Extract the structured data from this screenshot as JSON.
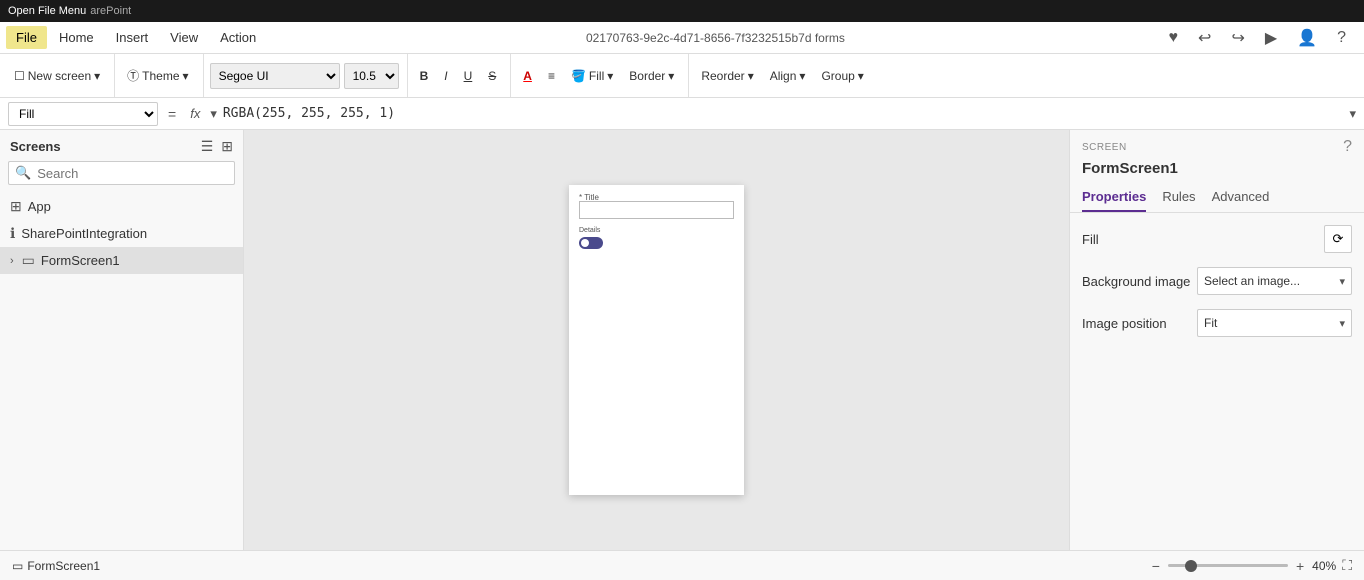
{
  "titlebar": {
    "open_file_menu": "Open File Menu",
    "sharepoint": "arePoint"
  },
  "menubar": {
    "items": [
      "File",
      "Home",
      "Insert",
      "View",
      "Action"
    ],
    "active_item": "File",
    "app_id": "02170763-9e2c-4d71-8656-7f3232515b7d forms"
  },
  "toolbar": {
    "new_screen_label": "New screen",
    "theme_label": "Theme",
    "font_name": "Segoe UI",
    "font_size": "10.5",
    "bold_label": "B",
    "italic_label": "I",
    "underline_label": "U",
    "strikethrough_label": "S",
    "font_color_label": "A",
    "align_label": "≡",
    "fill_label": "Fill",
    "border_label": "Border",
    "reorder_label": "Reorder",
    "align_btn_label": "Align",
    "group_label": "Group"
  },
  "formula_bar": {
    "property": "Fill",
    "equals_sign": "=",
    "fx_label": "fx",
    "formula": "RGBA(255, 255, 255, 1)"
  },
  "sidebar": {
    "title": "Screens",
    "search_placeholder": "Search",
    "items": [
      {
        "id": "app",
        "label": "App",
        "icon": "grid"
      },
      {
        "id": "sharepoint",
        "label": "SharePointIntegration",
        "icon": "info-circle"
      },
      {
        "id": "formscreen",
        "label": "FormScreen1",
        "icon": "rectangle",
        "selected": true
      }
    ]
  },
  "canvas": {
    "screen_title_label": "* Title",
    "details_label": "Details"
  },
  "right_panel": {
    "section_label": "SCREEN",
    "title": "FormScreen1",
    "tabs": [
      "Properties",
      "Rules",
      "Advanced"
    ],
    "active_tab": "Properties",
    "fill_label": "Fill",
    "background_image_label": "Background image",
    "background_image_value": "Select an image...",
    "image_position_label": "Image position",
    "image_position_value": "Fit"
  },
  "bottom_bar": {
    "screen_name": "FormScreen1",
    "zoom_minus": "−",
    "zoom_plus": "+",
    "zoom_value": "40",
    "zoom_unit": "%"
  },
  "icons": {
    "search": "🔍",
    "list_view": "☰",
    "grid_view": "⊞",
    "grid": "⊞",
    "info": "ℹ",
    "rectangle": "▭",
    "chevron_down": "▾",
    "chevron_right": "›",
    "undo": "↩",
    "redo": "↪",
    "play": "▶",
    "user": "👤",
    "help": "?",
    "paint": "🎨",
    "expand": "⛶",
    "refresh_icon": "⟳"
  }
}
